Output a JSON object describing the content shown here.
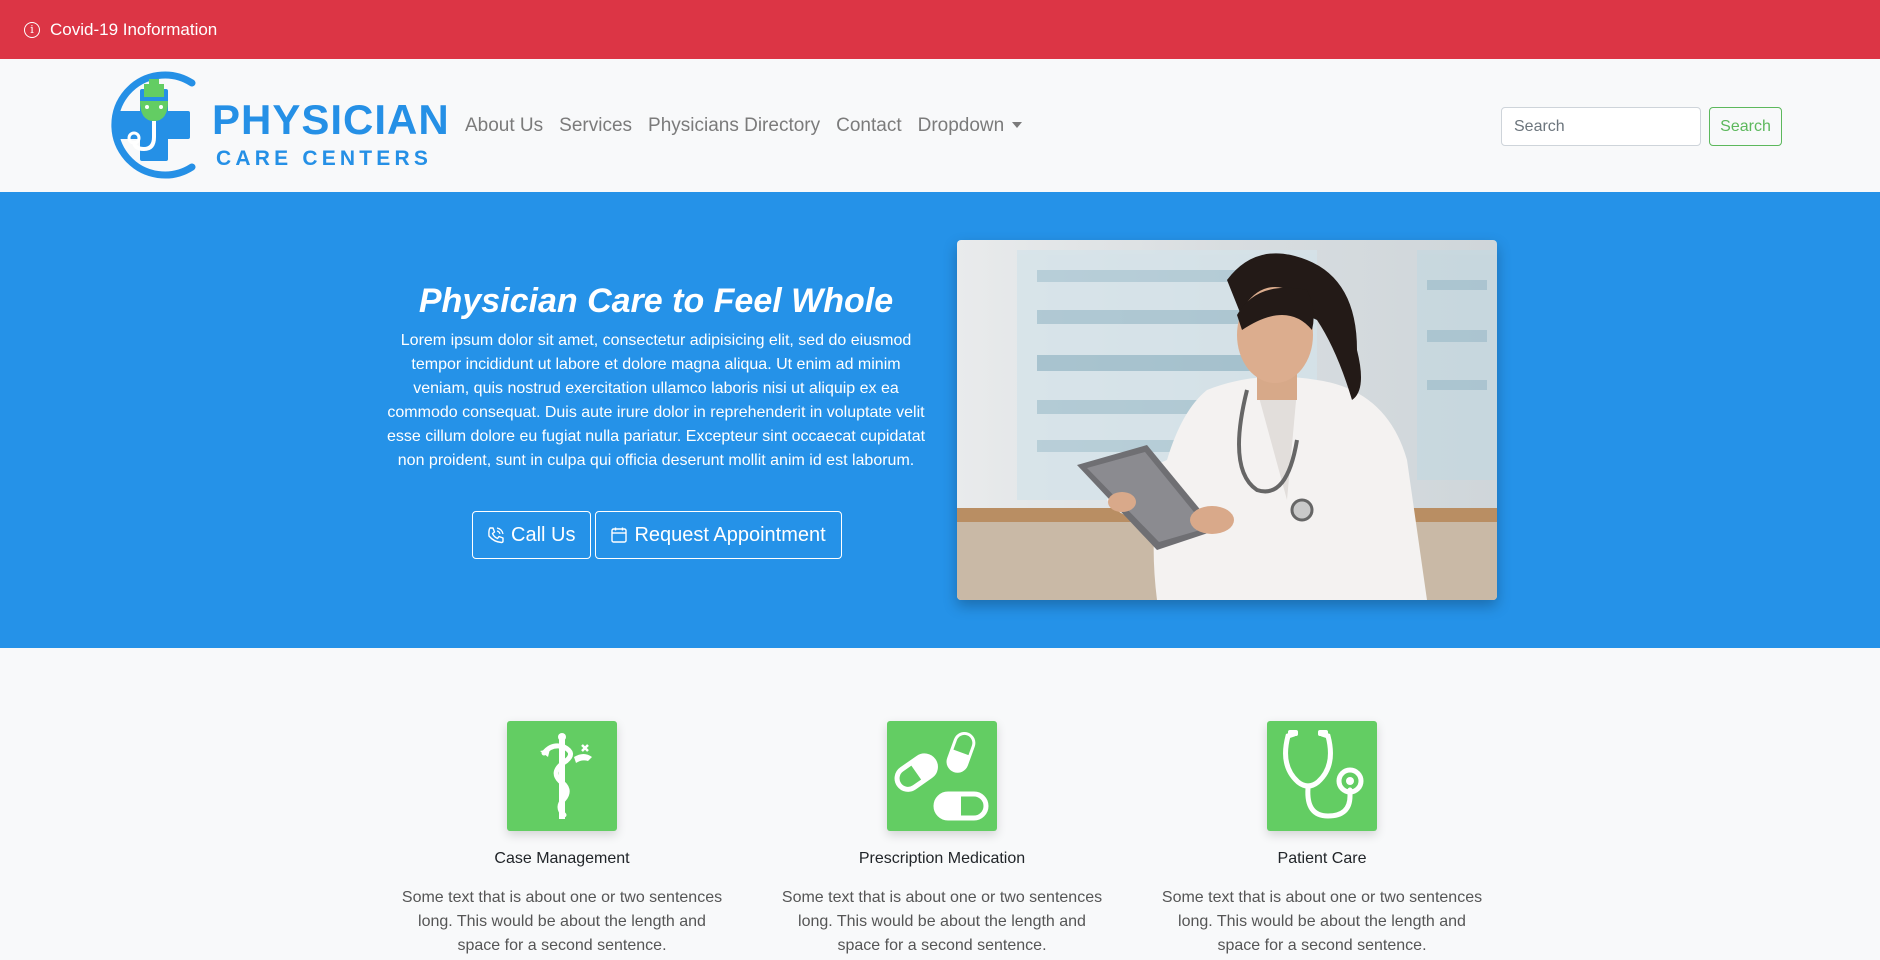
{
  "alert": {
    "icon": "info-circle-icon",
    "text": "Covid-19 Inoformation"
  },
  "brand": {
    "title": "PHYSICIAN",
    "subtitle": "CARE CENTERS",
    "colors": {
      "blue": "#2590e6",
      "green": "#63cd63"
    }
  },
  "nav": {
    "links": [
      "About Us",
      "Services",
      "Physicians Directory",
      "Contact",
      "Dropdown"
    ]
  },
  "search": {
    "placeholder": "Search",
    "button_label": "Search"
  },
  "hero": {
    "title": "Physician Care to Feel Whole",
    "text": "Lorem ipsum dolor sit amet, consectetur adipisicing elit, sed do eiusmod tempor incididunt ut labore et dolore magna aliqua. Ut enim ad minim veniam, quis nostrud exercitation ullamco laboris nisi ut aliquip ex ea commodo consequat. Duis aute irure dolor in reprehenderit in voluptate velit esse cillum dolore eu fugiat nulla pariatur. Excepteur sint occaecat cupidatat non proident, sunt in culpa qui officia deserunt mollit anim id est laborum.",
    "call_label": "Call Us",
    "appointment_label": "Request Appointment",
    "background": "#2592e8"
  },
  "features": [
    {
      "icon": "caduceus-icon",
      "title": "Case Management",
      "text": "Some text that is about one or two sentences long. This would be about the length and space for a second sentence."
    },
    {
      "icon": "pills-icon",
      "title": "Prescription Medication",
      "text": "Some text that is about one or two sentences long. This would be about the length and space for a second sentence."
    },
    {
      "icon": "stethoscope-icon",
      "title": "Patient Care",
      "text": "Some text that is about one or two sentences long. This would be about the length and space for a second sentence."
    }
  ],
  "colors": {
    "alert": "#dc3545",
    "search_button": "#5cb85c",
    "feature_icon_bg": "#63cd63"
  }
}
